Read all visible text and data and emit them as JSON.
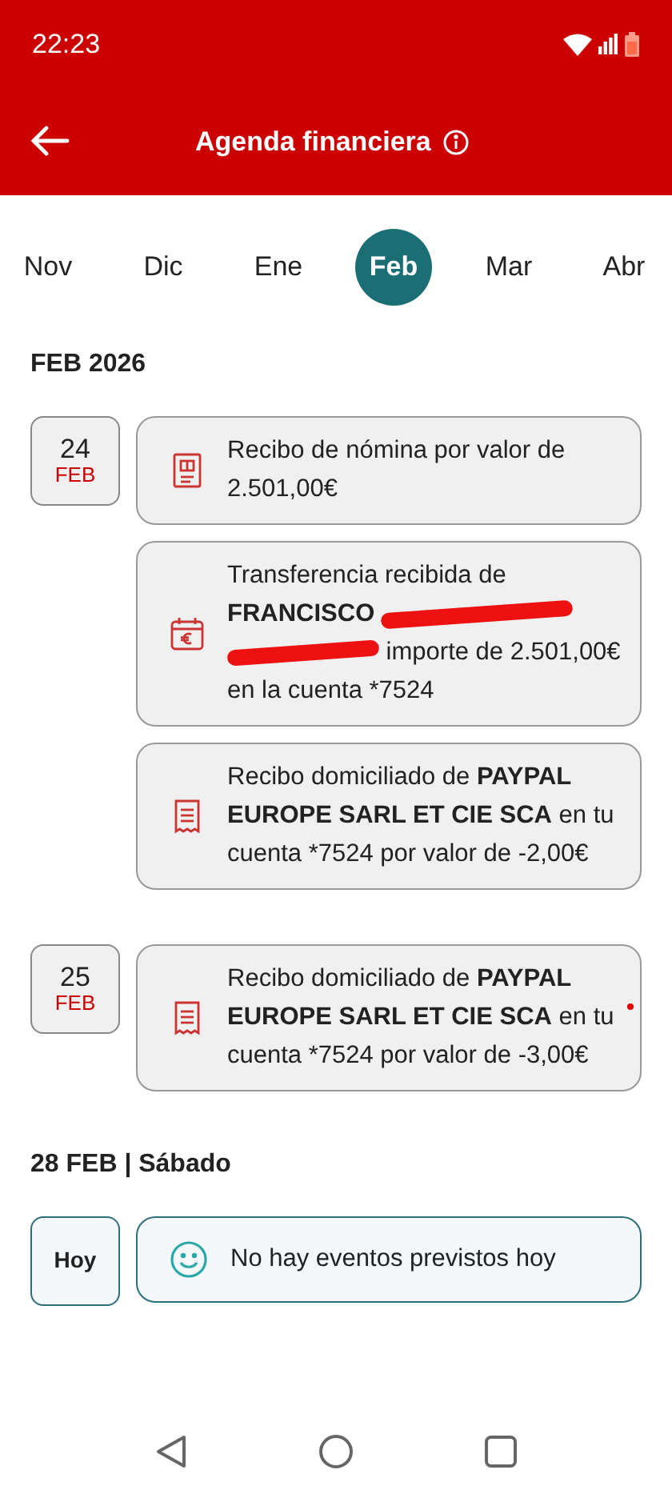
{
  "status_bar": {
    "time": "22:23"
  },
  "header": {
    "title": "Agenda financiera"
  },
  "months": [
    {
      "label": "Nov",
      "selected": false
    },
    {
      "label": "Dic",
      "selected": false
    },
    {
      "label": "Ene",
      "selected": false
    },
    {
      "label": "Feb",
      "selected": true
    },
    {
      "label": "Mar",
      "selected": false
    },
    {
      "label": "Abr",
      "selected": false
    }
  ],
  "sections": [
    {
      "heading": "FEB 2026",
      "days": [
        {
          "kind": "date",
          "day": "24",
          "month": "FEB",
          "events": [
            {
              "kind": "payslip",
              "marker": false,
              "parts": [
                {
                  "kind": "text",
                  "text": "Recibo de nómina por valor de 2.501,00€"
                }
              ]
            },
            {
              "kind": "calendar-euro",
              "marker": false,
              "parts": [
                {
                  "kind": "text",
                  "text": "Transferencia recibida de **FRANCISCO**"
                },
                {
                  "kind": "redaction"
                },
                {
                  "kind": "redaction"
                },
                {
                  "kind": "text",
                  "text": "importe de 2.501,00€  en la cuenta *7524"
                }
              ]
            },
            {
              "kind": "receipt",
              "marker": false,
              "parts": [
                {
                  "kind": "text",
                  "text": "Recibo domiciliado de **PAYPAL EUROPE SARL ET CIE SCA** en tu cuenta *7524  por valor de -2,00€"
                }
              ]
            }
          ]
        },
        {
          "kind": "date",
          "day": "25",
          "month": "FEB",
          "events": [
            {
              "kind": "receipt",
              "marker": true,
              "parts": [
                {
                  "kind": "text",
                  "text": "Recibo domiciliado de **PAYPAL EUROPE SARL ET CIE SCA** en tu cuenta *7524  por valor de -3,00€"
                }
              ]
            }
          ]
        }
      ]
    },
    {
      "heading": "28 FEB | Sábado",
      "days": [
        {
          "kind": "today",
          "label": "Hoy",
          "events": [
            {
              "kind": "smile",
              "marker": false,
              "parts": [
                {
                  "kind": "text",
                  "text": "No hay eventos previstos hoy"
                }
              ]
            }
          ]
        }
      ]
    }
  ]
}
